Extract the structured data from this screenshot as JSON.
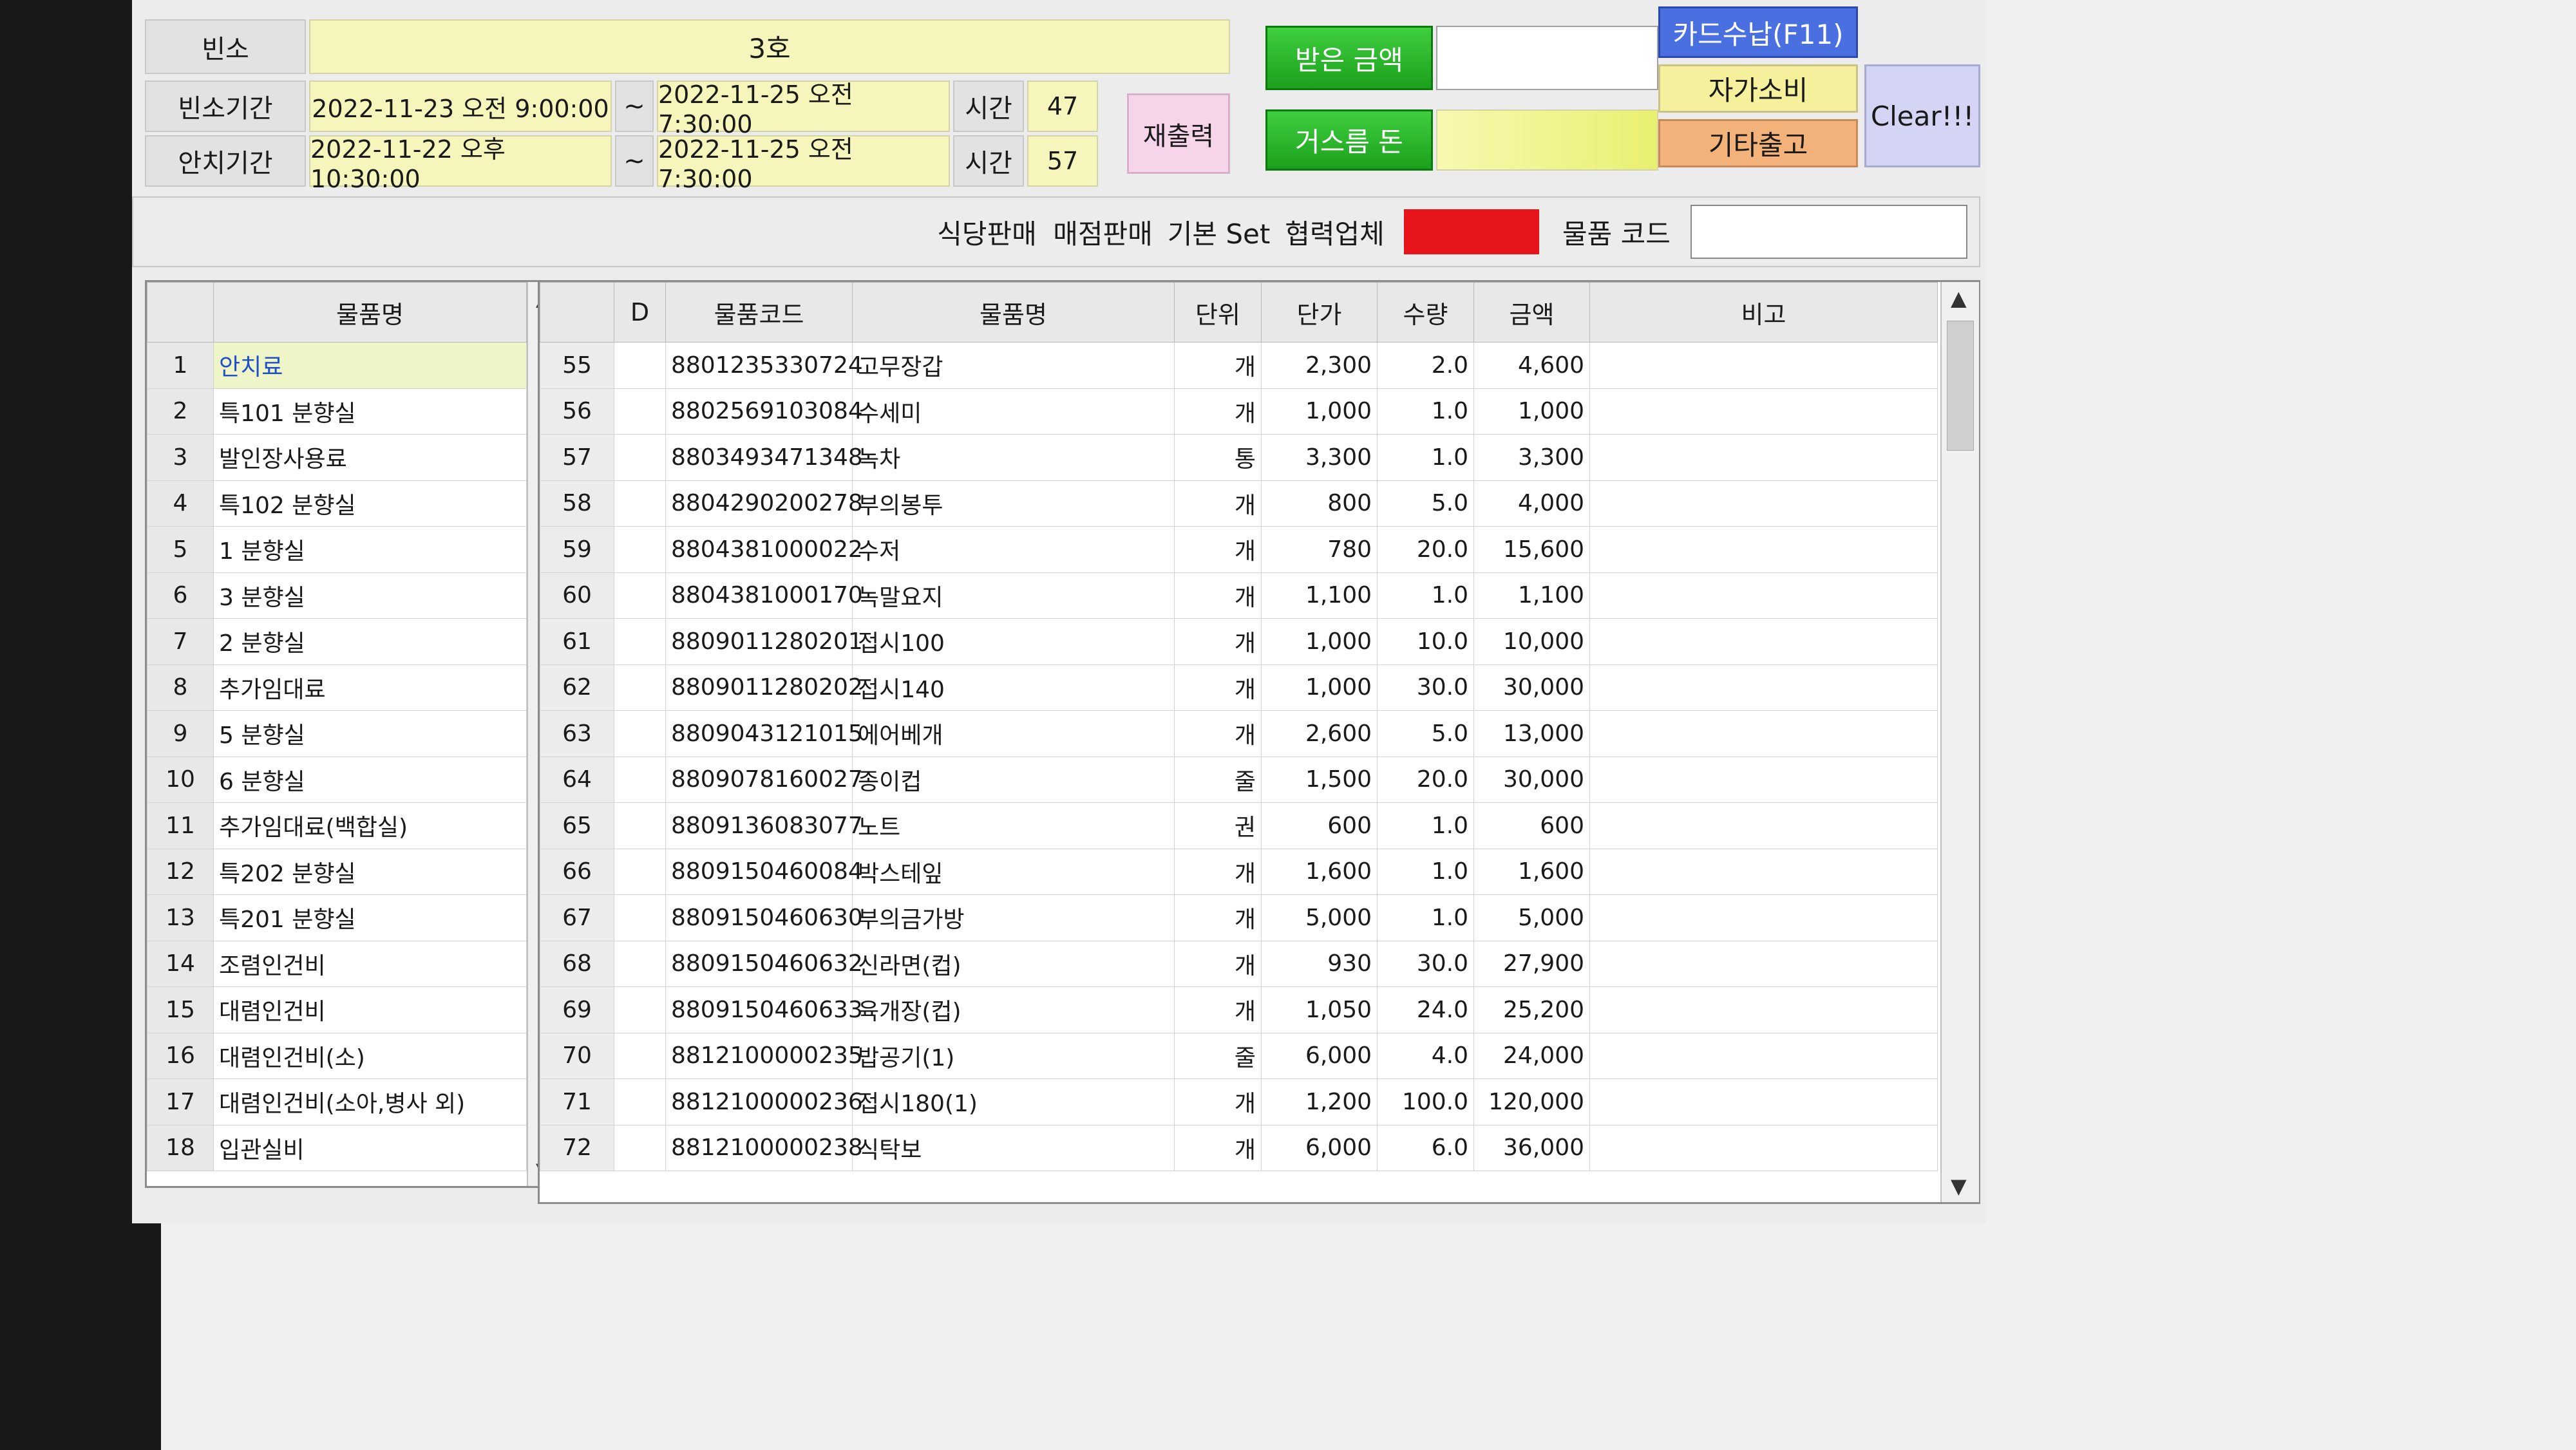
{
  "top": {
    "room_label": "빈소",
    "room_value": "3호",
    "mourning_label": "빈소기간",
    "mourning_start": "2022-11-23 오전 9:00:00",
    "mourning_end": "2022-11-25 오전 7:30:00",
    "mourning_hours_label": "시간",
    "mourning_hours": "47",
    "placement_label": "안치기간",
    "placement_start": "2022-11-22 오후 10:30:00",
    "placement_end": "2022-11-25 오전 7:30:00",
    "placement_hours_label": "시간",
    "placement_hours": "57",
    "tilde": "~",
    "reprint_label": "재출력"
  },
  "payment": {
    "received_label": "받은 금액",
    "received_value": "",
    "change_label": "거스름 돈",
    "change_value": "",
    "card_button": "카드수납(F11)",
    "self_use_button": "자가소비",
    "other_out_button": "기타출고",
    "clear_button": "Clear!!!"
  },
  "filter_bar": {
    "restaurant_sales": "식당판매",
    "store_sales": "매점판매",
    "basic_set": "기본 Set",
    "partner": "협력업체",
    "item_code_label": "물품 코드",
    "item_code_value": "",
    "indicator_color": "#e8141c"
  },
  "left_list": {
    "header": "물품명",
    "items": [
      {
        "no": "1",
        "name": "안치료"
      },
      {
        "no": "2",
        "name": "특101 분향실"
      },
      {
        "no": "3",
        "name": "발인장사용료"
      },
      {
        "no": "4",
        "name": "특102 분향실"
      },
      {
        "no": "5",
        "name": "1 분향실"
      },
      {
        "no": "6",
        "name": "3 분향실"
      },
      {
        "no": "7",
        "name": "2 분향실"
      },
      {
        "no": "8",
        "name": "추가임대료"
      },
      {
        "no": "9",
        "name": "5 분향실"
      },
      {
        "no": "10",
        "name": "6 분향실"
      },
      {
        "no": "11",
        "name": "추가임대료(백합실)"
      },
      {
        "no": "12",
        "name": "특202 분향실"
      },
      {
        "no": "13",
        "name": "특201 분향실"
      },
      {
        "no": "14",
        "name": "조렴인건비"
      },
      {
        "no": "15",
        "name": "대렴인건비"
      },
      {
        "no": "16",
        "name": "대렴인건비(소)"
      },
      {
        "no": "17",
        "name": "대렴인건비(소아,병사 외)"
      },
      {
        "no": "18",
        "name": "입관실비"
      }
    ]
  },
  "main_table": {
    "headers": [
      "D",
      "물품코드",
      "물품명",
      "단위",
      "단가",
      "수량",
      "금액",
      "비고"
    ],
    "rows": [
      {
        "no": "55",
        "code": "8801235330724",
        "name": "고무장갑",
        "unit": "개",
        "price": "2,300",
        "qty": "2.0",
        "amount": "4,600"
      },
      {
        "no": "56",
        "code": "8802569103084",
        "name": "수세미",
        "unit": "개",
        "price": "1,000",
        "qty": "1.0",
        "amount": "1,000"
      },
      {
        "no": "57",
        "code": "8803493471348",
        "name": "녹차",
        "unit": "통",
        "price": "3,300",
        "qty": "1.0",
        "amount": "3,300"
      },
      {
        "no": "58",
        "code": "8804290200278",
        "name": "부의봉투",
        "unit": "개",
        "price": "800",
        "qty": "5.0",
        "amount": "4,000"
      },
      {
        "no": "59",
        "code": "8804381000022",
        "name": "수저",
        "unit": "개",
        "price": "780",
        "qty": "20.0",
        "amount": "15,600"
      },
      {
        "no": "60",
        "code": "8804381000170",
        "name": "녹말요지",
        "unit": "개",
        "price": "1,100",
        "qty": "1.0",
        "amount": "1,100"
      },
      {
        "no": "61",
        "code": "8809011280201",
        "name": "접시100",
        "unit": "개",
        "price": "1,000",
        "qty": "10.0",
        "amount": "10,000"
      },
      {
        "no": "62",
        "code": "8809011280202",
        "name": "접시140",
        "unit": "개",
        "price": "1,000",
        "qty": "30.0",
        "amount": "30,000"
      },
      {
        "no": "63",
        "code": "8809043121015",
        "name": "에어베개",
        "unit": "개",
        "price": "2,600",
        "qty": "5.0",
        "amount": "13,000"
      },
      {
        "no": "64",
        "code": "8809078160027",
        "name": "종이컵",
        "unit": "줄",
        "price": "1,500",
        "qty": "20.0",
        "amount": "30,000"
      },
      {
        "no": "65",
        "code": "8809136083077",
        "name": "노트",
        "unit": "권",
        "price": "600",
        "qty": "1.0",
        "amount": "600"
      },
      {
        "no": "66",
        "code": "8809150460084",
        "name": "박스테잎",
        "unit": "개",
        "price": "1,600",
        "qty": "1.0",
        "amount": "1,600"
      },
      {
        "no": "67",
        "code": "8809150460630",
        "name": "부의금가방",
        "unit": "개",
        "price": "5,000",
        "qty": "1.0",
        "amount": "5,000"
      },
      {
        "no": "68",
        "code": "8809150460632",
        "name": "신라면(컵)",
        "unit": "개",
        "price": "930",
        "qty": "30.0",
        "amount": "27,900"
      },
      {
        "no": "69",
        "code": "8809150460633",
        "name": "육개장(컵)",
        "unit": "개",
        "price": "1,050",
        "qty": "24.0",
        "amount": "25,200"
      },
      {
        "no": "70",
        "code": "8812100000235",
        "name": "밥공기(1)",
        "unit": "줄",
        "price": "6,000",
        "qty": "4.0",
        "amount": "24,000"
      },
      {
        "no": "71",
        "code": "8812100000236",
        "name": "접시180(1)",
        "unit": "개",
        "price": "1,200",
        "qty": "100.0",
        "amount": "120,000"
      },
      {
        "no": "72",
        "code": "8812100000238",
        "name": "식탁보",
        "unit": "개",
        "price": "6,000",
        "qty": "6.0",
        "amount": "36,000"
      }
    ]
  },
  "icons": {
    "scroll_up": "▲",
    "scroll_down": "▼"
  }
}
